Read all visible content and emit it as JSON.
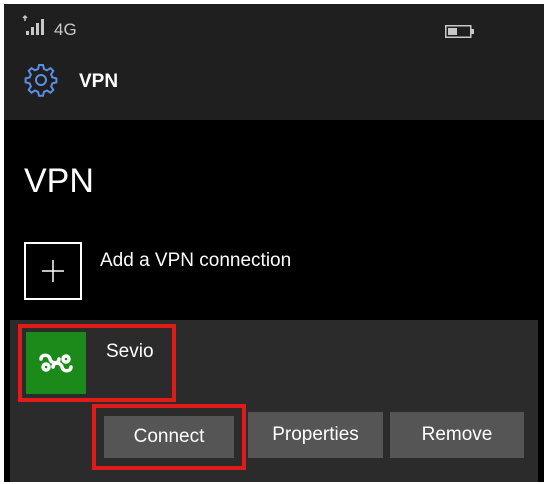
{
  "status_bar": {
    "signal_icon": "signal-strength-icon",
    "network": "4G",
    "battery_icon": "battery-icon"
  },
  "app_bar": {
    "icon": "gear-icon",
    "title": "VPN"
  },
  "page": {
    "title": "VPN"
  },
  "add_connection": {
    "icon": "plus-icon",
    "label": "Add a VPN connection"
  },
  "vpn_connection": {
    "icon": "sevio-logo-icon",
    "name": "Sevio",
    "tile_color": "#1b8a1b",
    "buttons": {
      "connect": "Connect",
      "properties": "Properties",
      "remove": "Remove"
    }
  },
  "colors": {
    "highlight": "#e11a1a",
    "background": "#000000",
    "bar_background": "#1f1f1f",
    "button": "#555555"
  }
}
